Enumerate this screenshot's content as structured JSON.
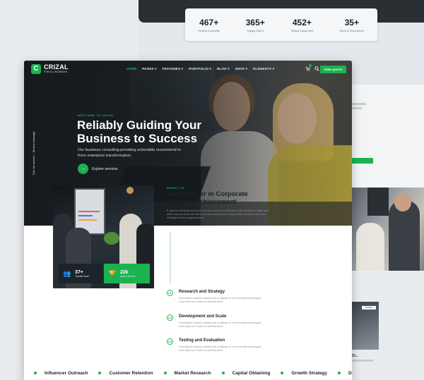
{
  "stats": [
    {
      "value": "467+",
      "label": "Project Complete"
    },
    {
      "value": "365+",
      "label": "Happy Client"
    },
    {
      "value": "452+",
      "label": "Global Equipment"
    },
    {
      "value": "35+",
      "label": "Years of Experience"
    }
  ],
  "background_card": {
    "badge": "Strategy",
    "title": "Di..."
  },
  "nav": {
    "logo_letter": "C",
    "logo_name": "CRIZAL",
    "logo_tagline": "FOR ALL BUSINESS",
    "menu": [
      "HOME",
      "PAGES ▾",
      "FEATURES ▾",
      "PORTFOLIO ▾",
      "BLOG ▾",
      "SHOP ▾",
      "ELEMENTS ▾"
    ],
    "cart_icon": "cart-icon",
    "search_icon": "search-icon",
    "cta": "FREE QUOTE"
  },
  "hero": {
    "side_note": "Get our service – Send a message",
    "welcome": "WELCOME TO CRIZAL",
    "title": "Reliably Guiding Your Business to Success",
    "description": "Our business consulting providing actionable recommend to force enterprise transformation.",
    "explore_label": "Explore services",
    "explore_icon": "→"
  },
  "about": {
    "stat_cards": [
      {
        "icon": "👥",
        "value": "37+",
        "label": "Trusted User"
      },
      {
        "icon": "🏆",
        "value": "22k",
        "label": "Award Winner"
      }
    ],
    "tag": "ABOUT US",
    "title": "Your Partner in Corporate Strategy Achievement",
    "description": "It seems most likely that there will be some form field before the decision is made that either way because we still don't know exactly how many people would be out of an existing all those pages around",
    "features": [
      {
        "num": "01",
        "title": "Research and Strategy",
        "desc": "Exercitation ullamco laboris nisi ut aliquip ex ea commodo consequat. Duis aute irure dolor in reprehenderit."
      },
      {
        "num": "02",
        "title": "Development and Scale",
        "desc": "Exercitation ullamco laboris nisi ut aliquip ex ea commodo consequat. Duis aute irure dolor in reprehenderit."
      },
      {
        "num": "03",
        "title": "Testing and Evaluation",
        "desc": "Exercitation ullamco laboris nisi ut aliquip ex ea commodo consequat. Duis aute irure dolor in reprehenderit."
      }
    ]
  },
  "marquee": [
    "Influencer Outreach",
    "Customer Retention",
    "Market Research",
    "Capital Obtaining",
    "Growth Strategy",
    "D"
  ],
  "colors": {
    "accent": "#1bb24f",
    "dark": "#1c2226"
  }
}
